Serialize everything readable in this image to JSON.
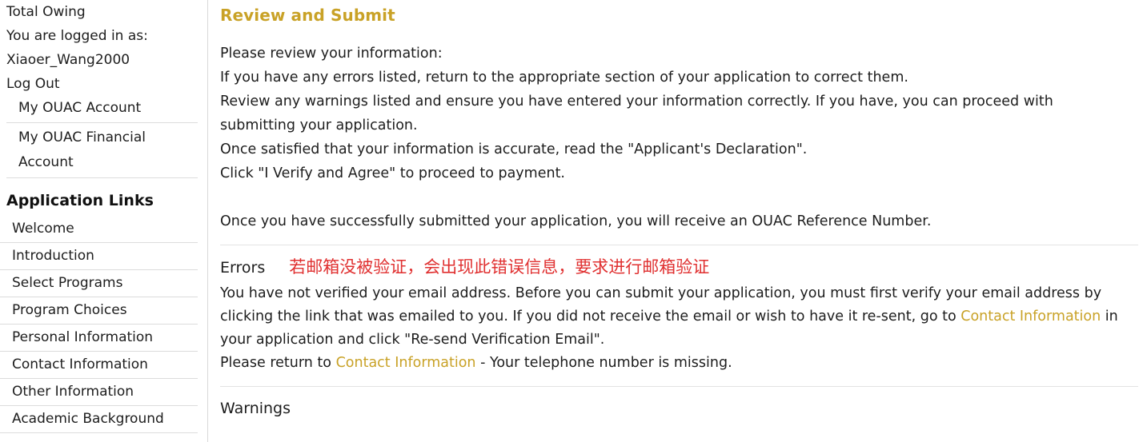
{
  "sidebar": {
    "total_owing_label": "Total Owing",
    "logged_in_label": "You are logged in as:",
    "username": "Xiaoer_Wang2000",
    "log_out_label": "Log Out",
    "account_items": [
      {
        "label": "My OUAC Account"
      },
      {
        "label": "My OUAC Financial Account"
      }
    ],
    "application_links_heading": "Application Links",
    "nav_items": [
      {
        "label": "Welcome"
      },
      {
        "label": "Introduction"
      },
      {
        "label": "Select Programs"
      },
      {
        "label": "Program Choices"
      },
      {
        "label": "Personal Information"
      },
      {
        "label": "Contact Information"
      },
      {
        "label": "Other Information"
      },
      {
        "label": "Academic Background"
      }
    ]
  },
  "main": {
    "title": "Review and Submit",
    "intro_lines": [
      "Please review your information:",
      "If you have any errors listed, return to the appropriate section of your application to correct them.",
      "Review any warnings listed and ensure you have entered your information correctly. If you have, you can proceed with submitting your application.",
      "Once satisfied that your information is accurate, read the \"Applicant's Declaration\".",
      "Click \"I Verify and Agree\" to proceed to payment."
    ],
    "reference_line": "Once you have successfully submitted your application, you will receive an OUAC Reference Number.",
    "errors": {
      "heading": "Errors",
      "annotation": "若邮箱没被验证，会出现此错误信息，要求进行邮箱验证",
      "annotation_color": "#e03030",
      "message_part_1": "You have not verified your email address. Before you can submit your application, you must first verify your email address by clicking the link that was emailed to you. If you did not receive the email or wish to have it re-sent, go to ",
      "link_1": "Contact Information",
      "message_part_2": " in your application and click \"Re-send Verification Email\".",
      "message_part_3": "Please return to ",
      "link_2": "Contact Information",
      "message_part_4": " - Your telephone number is missing."
    },
    "warnings": {
      "heading": "Warnings"
    }
  },
  "colors": {
    "accent_gold": "#c9a227",
    "error_red": "#e03030",
    "text": "#1d1d1d",
    "rule": "#e3e3e3"
  }
}
